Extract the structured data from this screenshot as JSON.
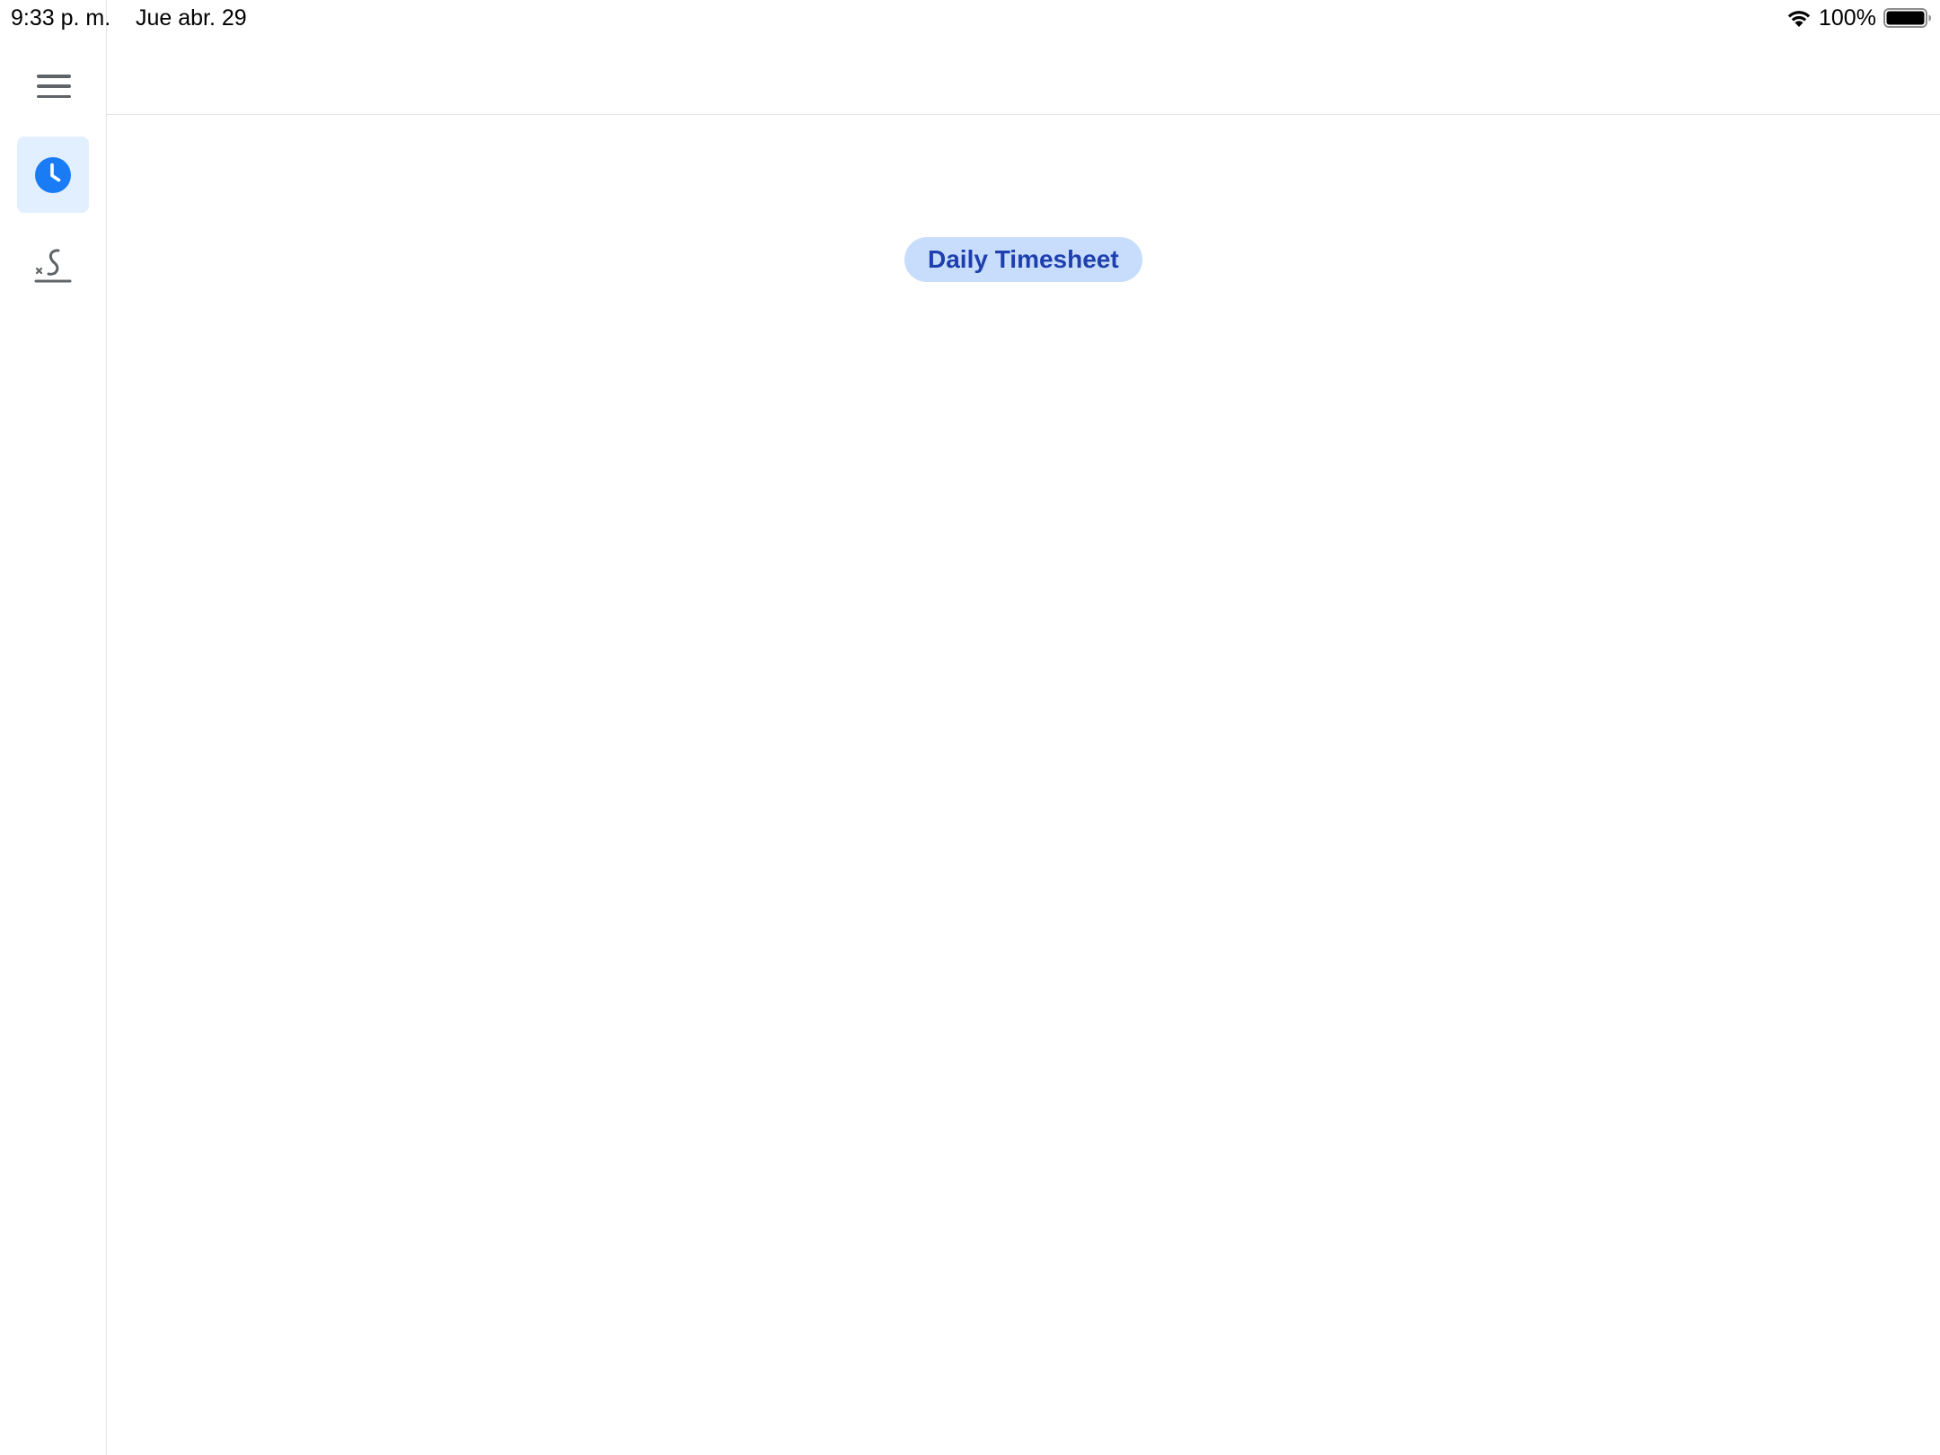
{
  "status_bar": {
    "time": "9:33 p. m.",
    "date": "Jue abr. 29",
    "battery_percent": "100%",
    "battery_level": 1.0,
    "wifi_icon": "wifi-icon",
    "battery_icon": "battery-icon"
  },
  "nav_rail": {
    "menu_icon": "hamburger-menu-icon",
    "items": [
      {
        "id": "timesheet",
        "icon": "clock-icon",
        "active": true
      },
      {
        "id": "signature",
        "icon": "signature-icon",
        "active": false
      }
    ]
  },
  "main": {
    "title": "Daily Timesheet"
  },
  "colors": {
    "accent": "#1a7cf5",
    "active_nav_bg": "#e2efff",
    "chip_bg": "#c7ddfb",
    "chip_text": "#1e3fae",
    "icon_gray": "#5f6368",
    "divider": "#e4e4e7"
  }
}
